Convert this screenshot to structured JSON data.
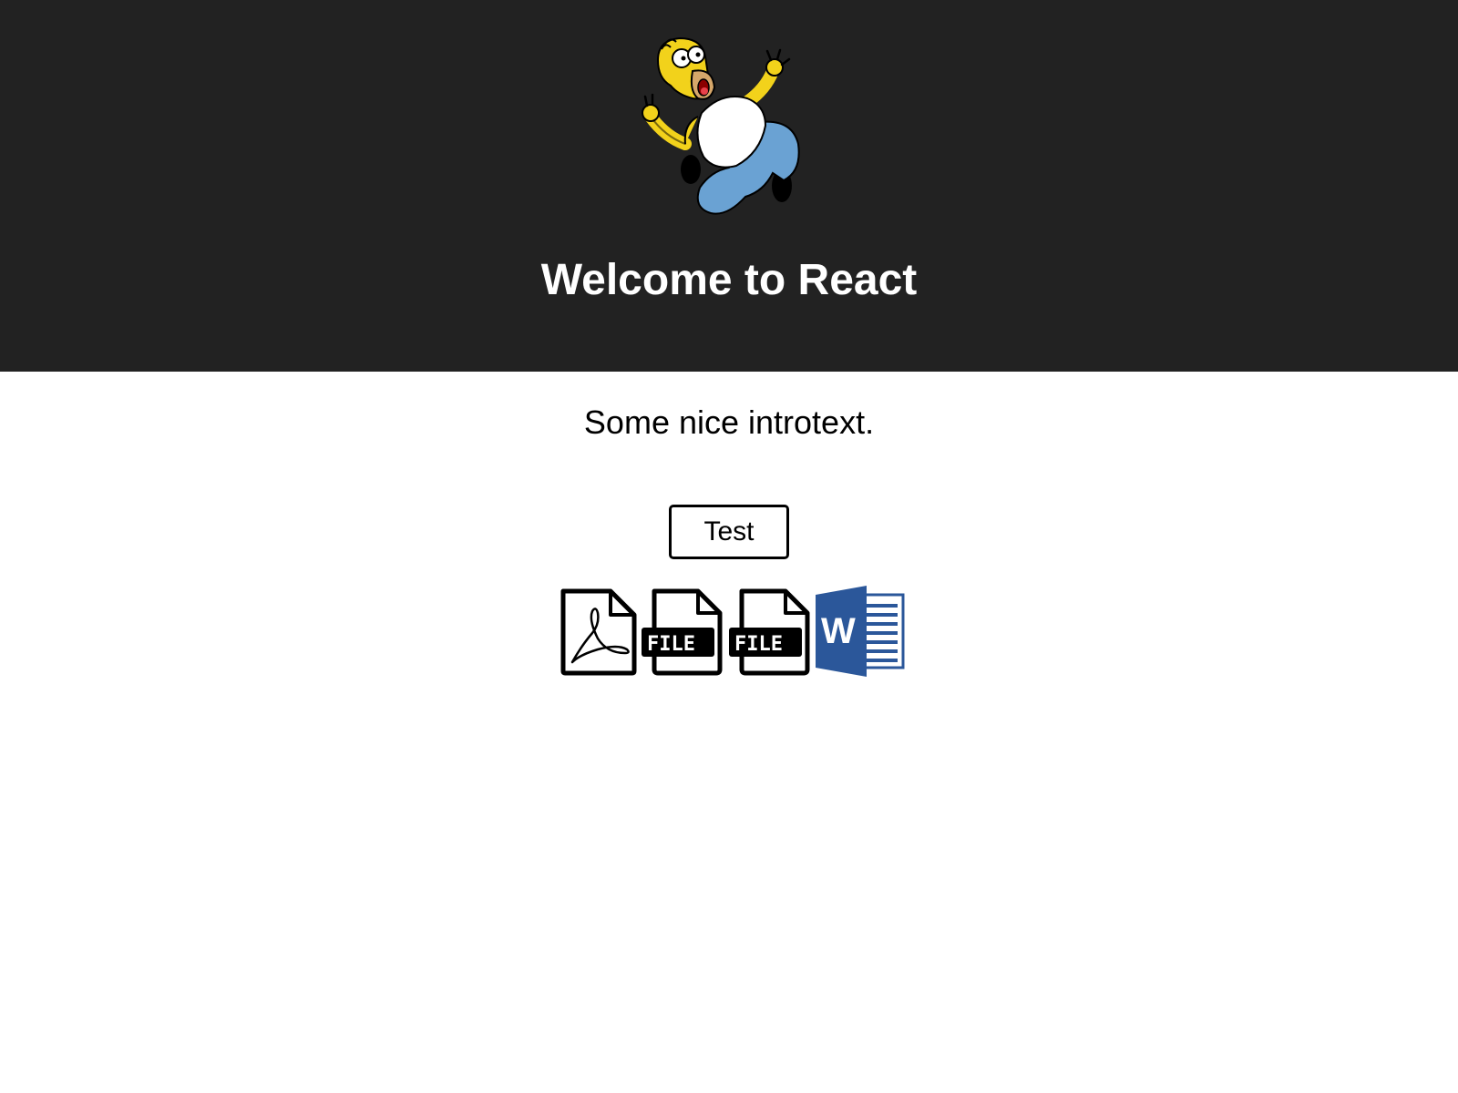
{
  "header": {
    "title": "Welcome to React",
    "logo_icon": "homer-simpson-logo",
    "background_color": "#222222"
  },
  "main": {
    "intro_text": "Some nice introtext.",
    "test_button_label": "Test"
  },
  "file_icons": [
    {
      "icon": "pdf-file-icon"
    },
    {
      "icon": "generic-file-icon",
      "label": "FILE"
    },
    {
      "icon": "generic-file-icon",
      "label": "FILE"
    },
    {
      "icon": "word-file-icon",
      "label": "W",
      "color": "#2b579a"
    }
  ]
}
